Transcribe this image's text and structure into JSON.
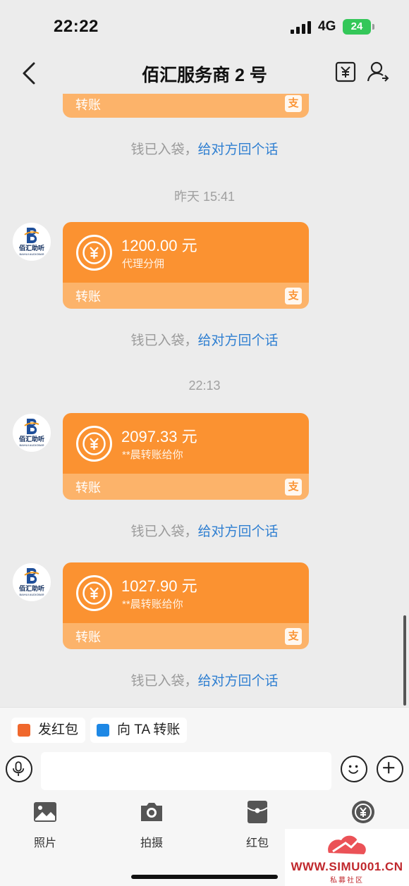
{
  "status_bar": {
    "time": "22:22",
    "network": "4G",
    "battery": "24"
  },
  "nav": {
    "title": "佰汇服务商 2 号"
  },
  "avatar": {
    "brand_cn": "佰汇助听",
    "brand_en": "BAIHUI AUDIOBAR"
  },
  "messages": [
    {
      "type": "transfer_partial",
      "label": "转账"
    },
    {
      "type": "system",
      "text": "钱已入袋，",
      "link": "给对方回个话"
    },
    {
      "type": "timestamp",
      "text": "昨天 15:41"
    },
    {
      "type": "transfer",
      "amount": "1200.00 元",
      "note": "代理分佣",
      "label": "转账"
    },
    {
      "type": "system",
      "text": "钱已入袋，",
      "link": "给对方回个话"
    },
    {
      "type": "timestamp",
      "text": "22:13"
    },
    {
      "type": "transfer",
      "amount": "2097.33 元",
      "note": "**晨转账给你",
      "label": "转账"
    },
    {
      "type": "system",
      "text": "钱已入袋，",
      "link": "给对方回个话"
    },
    {
      "type": "transfer",
      "amount": "1027.90 元",
      "note": "**晨转账给你",
      "label": "转账"
    },
    {
      "type": "system",
      "text": "钱已入袋，",
      "link": "给对方回个话"
    }
  ],
  "quick_actions": [
    {
      "label": "发红包",
      "icon": "red-envelope-icon",
      "color": "#f0682d"
    },
    {
      "label": "向 TA 转账",
      "icon": "transfer-icon",
      "color": "#1e88e5"
    }
  ],
  "input": {
    "placeholder": ""
  },
  "tools": [
    {
      "label": "照片",
      "icon": "photo-icon"
    },
    {
      "label": "拍摄",
      "icon": "camera-icon"
    },
    {
      "label": "红包",
      "icon": "red-packet-icon"
    },
    {
      "label": "",
      "icon": "transfer-coin-icon"
    }
  ],
  "watermark": {
    "site": "WWW.SIMU001.CN",
    "sub": "私募社区"
  },
  "colors": {
    "card_top": "#fb9231",
    "card_bottom": "#fcb36a",
    "link": "#2f7fd1",
    "battery": "#34c759"
  }
}
